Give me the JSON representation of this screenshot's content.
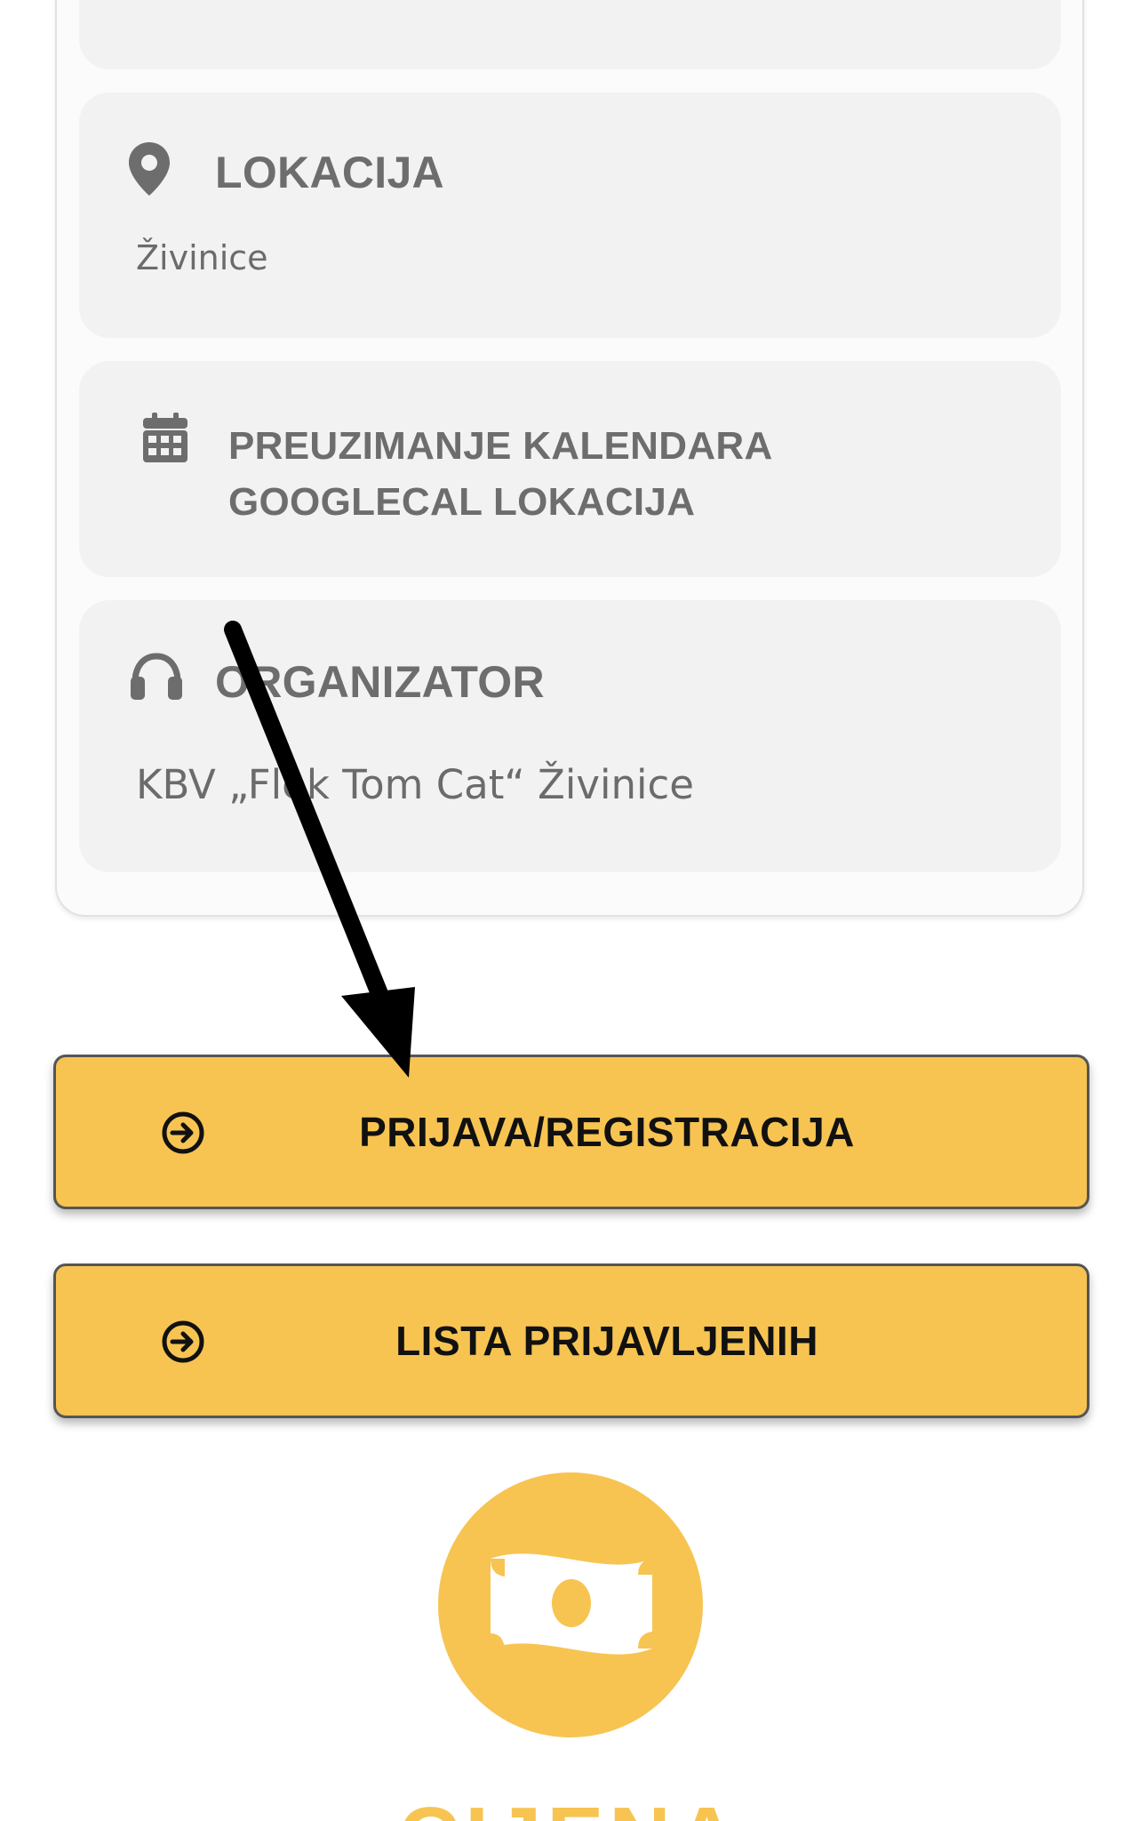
{
  "event_details": {
    "location": {
      "icon": "map-pin-icon",
      "title": "LOKACIJA",
      "value": "Živinice"
    },
    "calendar": {
      "icon": "calendar-icon",
      "title_line1": "PREUZIMANJE KALENDARA",
      "title_line2": "GOOGLECAL LOKACIJA"
    },
    "organizer": {
      "icon": "headphones-icon",
      "title": "ORGANIZATOR",
      "value": "KBV „Flek Tom Cat“ Živinice"
    }
  },
  "actions": [
    {
      "label": "PRIJAVA/REGISTRACIJA",
      "icon": "arrow-circle-right-icon"
    },
    {
      "label": "LISTA PRIJAVLJENIH",
      "icon": "arrow-circle-right-icon"
    }
  ],
  "price": {
    "icon": "money-bill-icon",
    "title": "CIJENA"
  },
  "annotation": {
    "icon": "arrow-annotation",
    "color": "#000000"
  },
  "colors": {
    "accent": "#f7c452",
    "card_bg": "#f2f2f2",
    "muted_text": "#6d6d6d"
  }
}
